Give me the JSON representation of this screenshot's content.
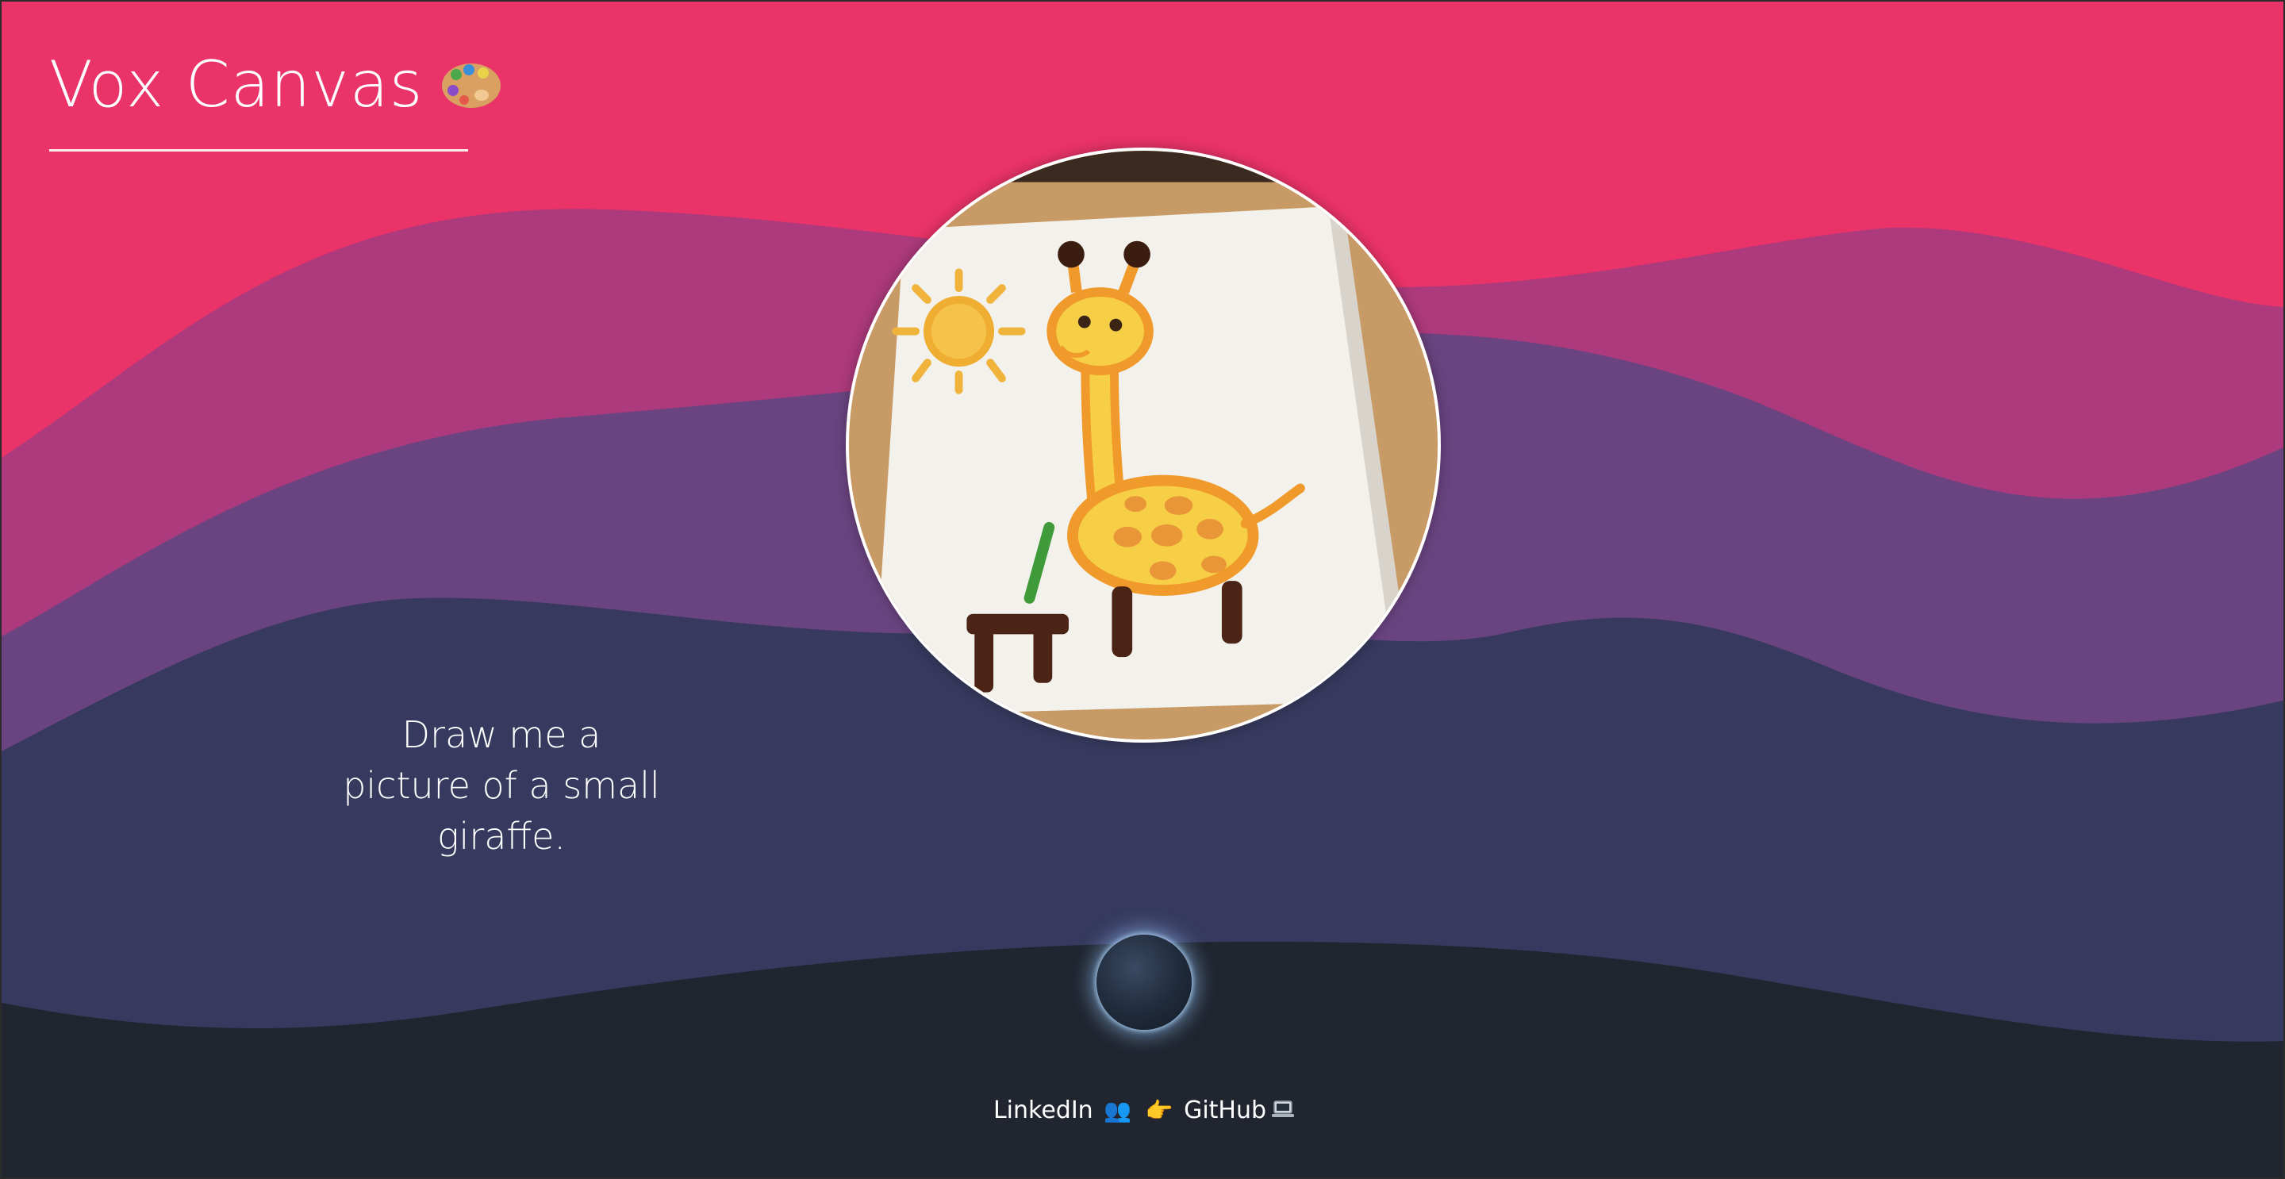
{
  "header": {
    "title": "Vox Canvas",
    "title_icon": "artist-palette-icon"
  },
  "main": {
    "image_alt": "child-style drawing of a small giraffe with a sun",
    "prompt": "Draw me a picture of a small giraffe."
  },
  "mic": {
    "icon": "microphone-orb-icon"
  },
  "footer": {
    "linkedin_label": "LinkedIn",
    "linkedin_icon": "👥",
    "separator_icon": "👉",
    "github_label": "GitHub",
    "github_icon": "laptop-icon"
  },
  "colors": {
    "wave_top": "#ea3368",
    "wave_magenta": "#ad3a7c",
    "wave_purple": "#6a4480",
    "wave_navy": "#373a5e",
    "wave_bottom": "#20252f",
    "text": "#ffffff"
  }
}
